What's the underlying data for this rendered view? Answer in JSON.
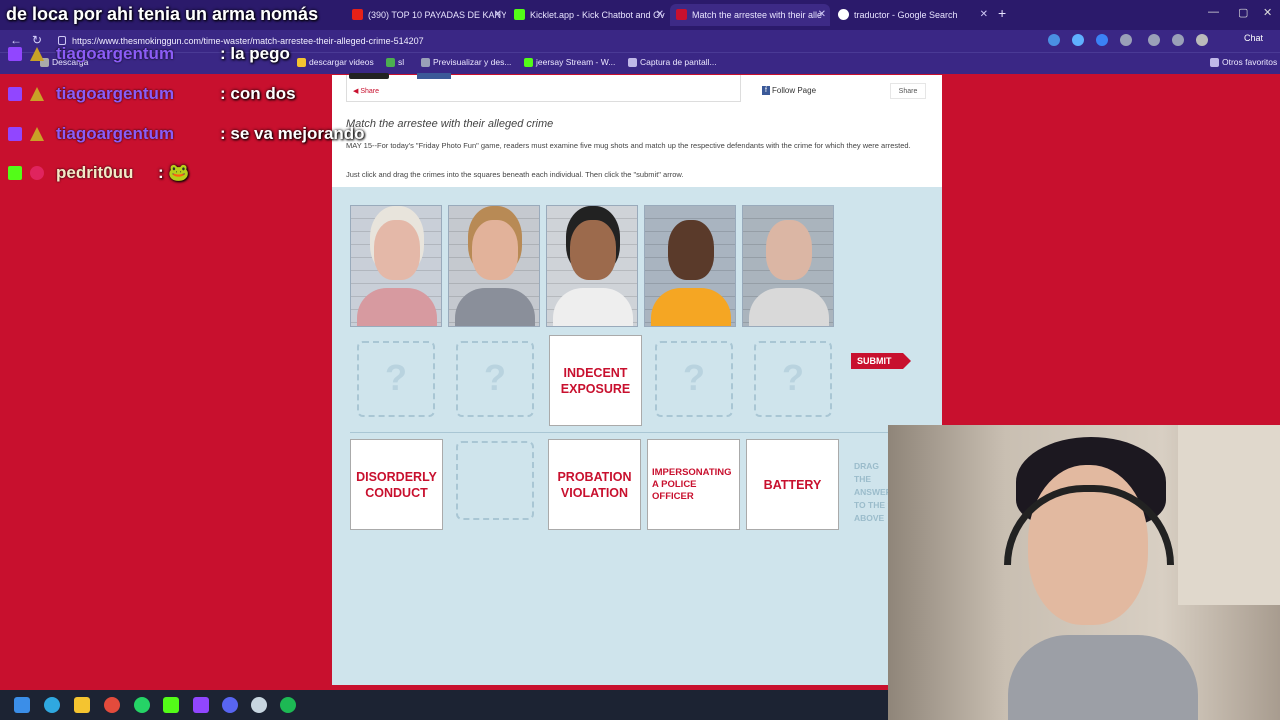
{
  "browser": {
    "tabs": [
      {
        "label": "(390) TOP 10 PAYADAS DE KANYE"
      },
      {
        "label": "Kicklet.app - Kick Chatbot and Ov"
      },
      {
        "label": "Match the arrestee with their alle"
      },
      {
        "label": "traductor - Google Search"
      }
    ],
    "url": "https://www.thesmokinggun.com/time-waster/match-arrestee-their-alleged-crime-514207",
    "bookmarks": [
      {
        "label": "Descarga"
      },
      {
        "label": "descargar videos"
      },
      {
        "label": "sl"
      },
      {
        "label": "Previsualizar y des..."
      },
      {
        "label": "jeersay Stream - W..."
      },
      {
        "label": "Captura de pantall..."
      },
      {
        "label": "Otros favoritos"
      }
    ],
    "copilot": "Chat"
  },
  "page": {
    "share_label": "Share",
    "follow_label": "Follow Page",
    "share_right": "Share",
    "title": "Match the arrestee with their alleged crime",
    "intro": "MAY 15--For today's \"Friday Photo Fun\" game, readers must examine five mug shots and match up the respective defendants with the crime for which they were arrested.",
    "instructions": "Just click and drag the crimes into the squares beneath each individual. Then click the \"submit\" arrow.",
    "placed_crime": "INDECENT EXPOSURE",
    "drop_placeholder": "?",
    "submit_label": "SUBMIT",
    "crimes": [
      {
        "label": "DISORDERLY CONDUCT"
      },
      {
        "label": "PROBATION VIOLATION"
      },
      {
        "label": "IMPERSONATING A POLICE OFFICER"
      },
      {
        "label": "BATTERY"
      }
    ],
    "drag_hint": "DRAG THE ANSWERS TO THE ? ABOVE"
  },
  "chat": {
    "banner": "de loca por ahi tenia un arma nomás",
    "messages": [
      {
        "user": "tiagoargentum",
        "text": ": la pego"
      },
      {
        "user": "tiagoargentum",
        "text": ": con dos"
      },
      {
        "user": "tiagoargentum",
        "text": ": se va mejorando"
      },
      {
        "user": "pedrit0uu",
        "text": ": 🐸"
      }
    ]
  },
  "colors": {
    "accent_red": "#c8102e",
    "browser_purple": "#3a2785",
    "page_blue": "#cfe4ec",
    "username_purple": "#8b5cf6"
  },
  "icons": [
    "back-icon",
    "refresh-icon",
    "lock-icon",
    "new-tab-icon",
    "share-icon",
    "facebook-icon",
    "windows-start-icon"
  ]
}
